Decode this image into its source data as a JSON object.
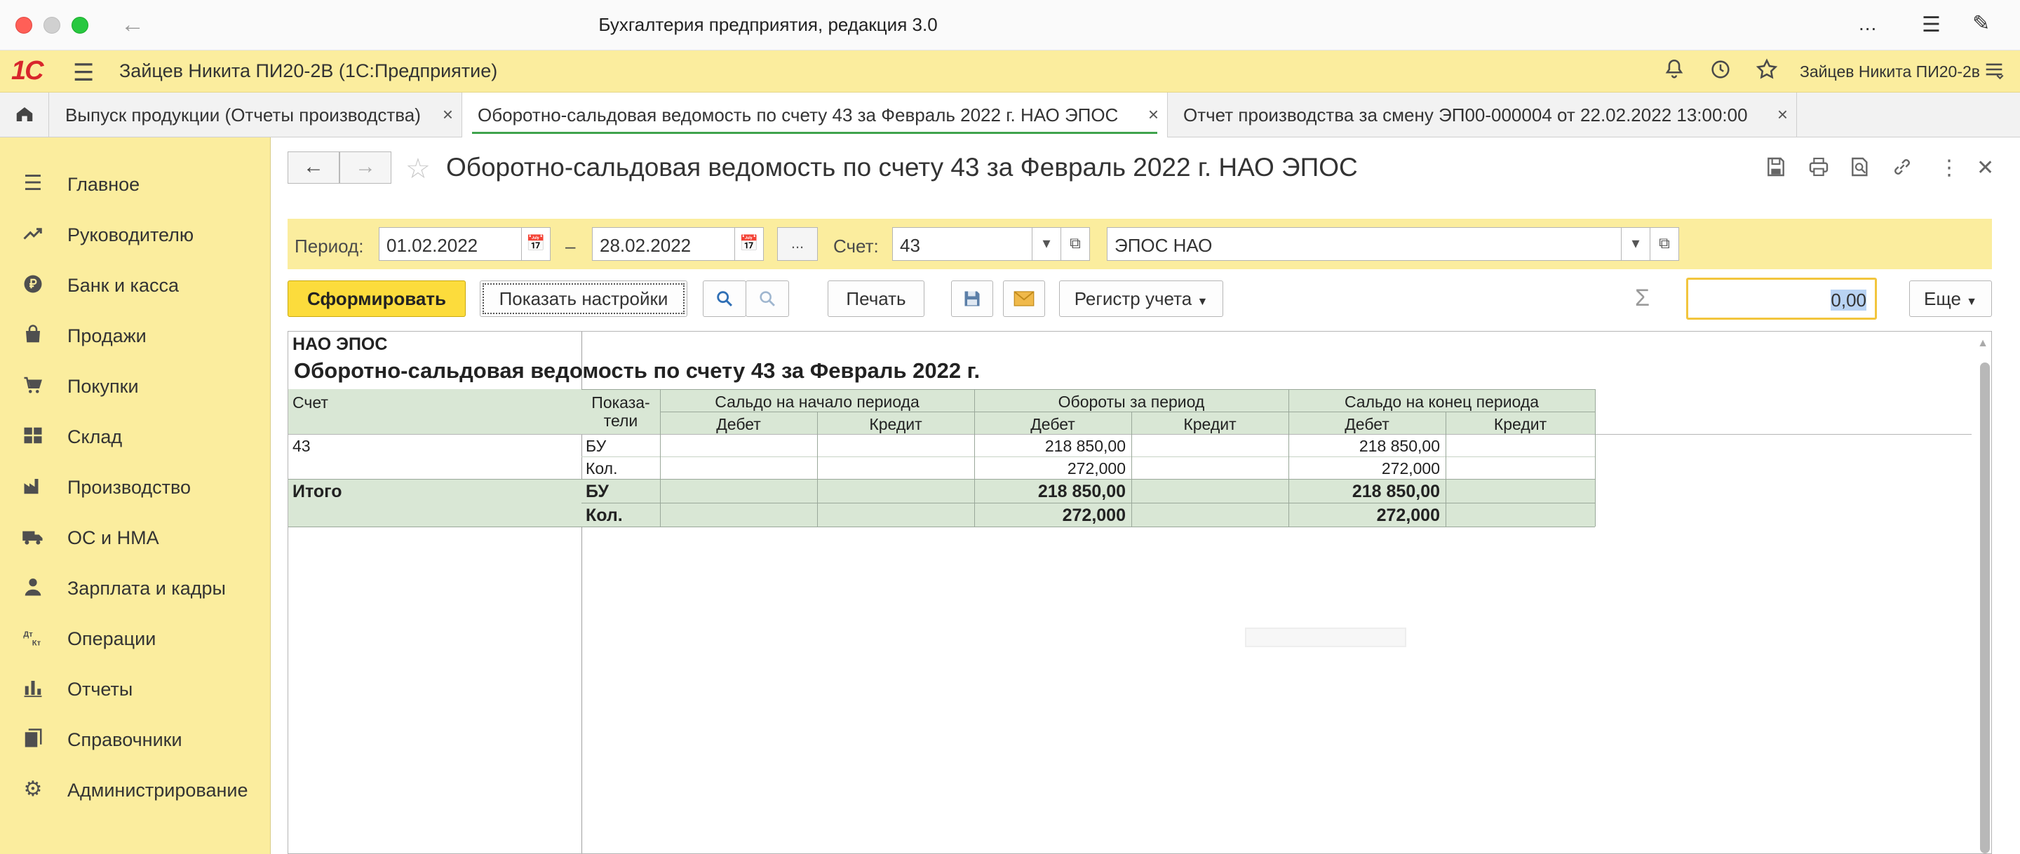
{
  "window": {
    "title": "Бухгалтерия предприятия, редакция 3.0",
    "more": "...",
    "back_icon": "arrow-left-icon",
    "menu_icon": "list-icon",
    "edit_icon": "pen-icon"
  },
  "appbar": {
    "logo": "1С",
    "user_app": "Зайцев Никита ПИ20-2В  (1С:Предприятие)",
    "user": "Зайцев Никита ПИ20-2в",
    "icons": [
      "bell-icon",
      "history-icon",
      "star-icon",
      "menu-icon"
    ]
  },
  "tabs": [
    {
      "label": "Выпуск продукции (Отчеты производства)",
      "active": false
    },
    {
      "label": "Оборотно-сальдовая ведомость по счету 43 за Февраль 2022 г. НАО ЭПОС",
      "active": true
    },
    {
      "label": "Отчет производства за смену ЭП00-000004 от 22.02.2022 13:00:00",
      "active": false
    }
  ],
  "tab_close": "×",
  "sidebar": {
    "items": [
      {
        "label": "Главное",
        "icon": "menu-lines-icon"
      },
      {
        "label": "Руководителю",
        "icon": "trend-icon"
      },
      {
        "label": "Банк и касса",
        "icon": "ruble-coin-icon"
      },
      {
        "label": "Продажи",
        "icon": "shopping-bag-icon"
      },
      {
        "label": "Покупки",
        "icon": "cart-icon"
      },
      {
        "label": "Склад",
        "icon": "warehouse-icon"
      },
      {
        "label": "Производство",
        "icon": "factory-icon"
      },
      {
        "label": "ОС и НМА",
        "icon": "truck-icon"
      },
      {
        "label": "Зарплата и кадры",
        "icon": "person-icon"
      },
      {
        "label": "Операции",
        "icon": "dt-kt-icon"
      },
      {
        "label": "Отчеты",
        "icon": "bar-chart-icon"
      },
      {
        "label": "Справочники",
        "icon": "books-icon"
      },
      {
        "label": "Администрирование",
        "icon": "gear-icon"
      }
    ]
  },
  "form": {
    "title": "Оборотно-сальдовая ведомость по счету 43 за Февраль 2022 г. НАО ЭПОС",
    "nav_back": "←",
    "nav_forward": "→",
    "header_icons": [
      "save-icon",
      "print-icon",
      "preview-icon",
      "link-icon",
      "more-vertical-icon",
      "close-icon"
    ]
  },
  "filters": {
    "period_label": "Период:",
    "date_from": "01.02.2022",
    "dash": "–",
    "date_to": "28.02.2022",
    "period_btn": "...",
    "account_label": "Счет:",
    "account": "43",
    "organization": "ЭПОС НАО"
  },
  "toolbar": {
    "generate": "Сформировать",
    "show_settings": "Показать настройки",
    "print": "Печать",
    "register": "Регистр учета",
    "sum_value": "0,00",
    "more": "Еще"
  },
  "report": {
    "org": "НАО ЭПОС",
    "title": "Оборотно-сальдовая ведомость по счету 43 за Февраль 2022 г.",
    "headers": {
      "account": "Счет",
      "indicators_1": "Показа-",
      "indicators_2": "тели",
      "opening": "Сальдо на начало периода",
      "turnover": "Обороты за период",
      "closing": "Сальдо на конец периода",
      "debit": "Дебет",
      "credit": "Кредит"
    },
    "rows": [
      {
        "account": "43",
        "indicator": "БУ",
        "open_dt": "",
        "open_kt": "",
        "turn_dt": "218 850,00",
        "turn_kt": "",
        "close_dt": "218 850,00",
        "close_kt": ""
      },
      {
        "account": "",
        "indicator": "Кол.",
        "open_dt": "",
        "open_kt": "",
        "turn_dt": "272,000",
        "turn_kt": "",
        "close_dt": "272,000",
        "close_kt": ""
      }
    ],
    "totals": [
      {
        "account": "Итого",
        "indicator": "БУ",
        "turn_dt": "218 850,00",
        "close_dt": "218 850,00"
      },
      {
        "account": "",
        "indicator": "Кол.",
        "turn_dt": "272,000",
        "close_dt": "272,000"
      }
    ]
  }
}
